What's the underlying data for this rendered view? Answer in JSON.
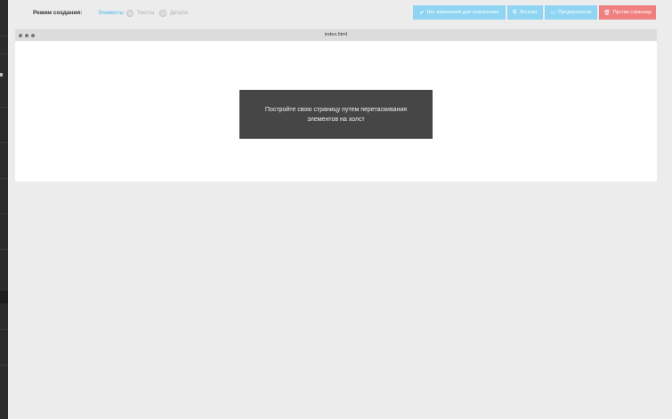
{
  "toolbar": {
    "mode_label": "Режим создания:",
    "modes": [
      {
        "label": "Элементы",
        "active": true
      },
      {
        "label": "Тексты",
        "active": false
      },
      {
        "label": "Детали",
        "active": false
      }
    ],
    "save_label": "Нет изменений для сохранения",
    "export_label": "Экспорт",
    "preview_label": "Предпросмотр",
    "clear_label": "Пустая страница"
  },
  "frame": {
    "title": "index.html"
  },
  "canvas": {
    "hint": "Постройте свою страницу путем перетаскивания элементов на холст"
  },
  "colors": {
    "accent": "#49b8ea",
    "button_blue": "#8fd5f3",
    "button_red": "#f08080",
    "dark": "#2b2b2b",
    "hint_bg": "#464646"
  },
  "icons": {
    "menu": "hamburger-icon",
    "save": "check-icon",
    "export": "export-icon",
    "preview": "preview-icon",
    "clear": "trash-icon"
  }
}
